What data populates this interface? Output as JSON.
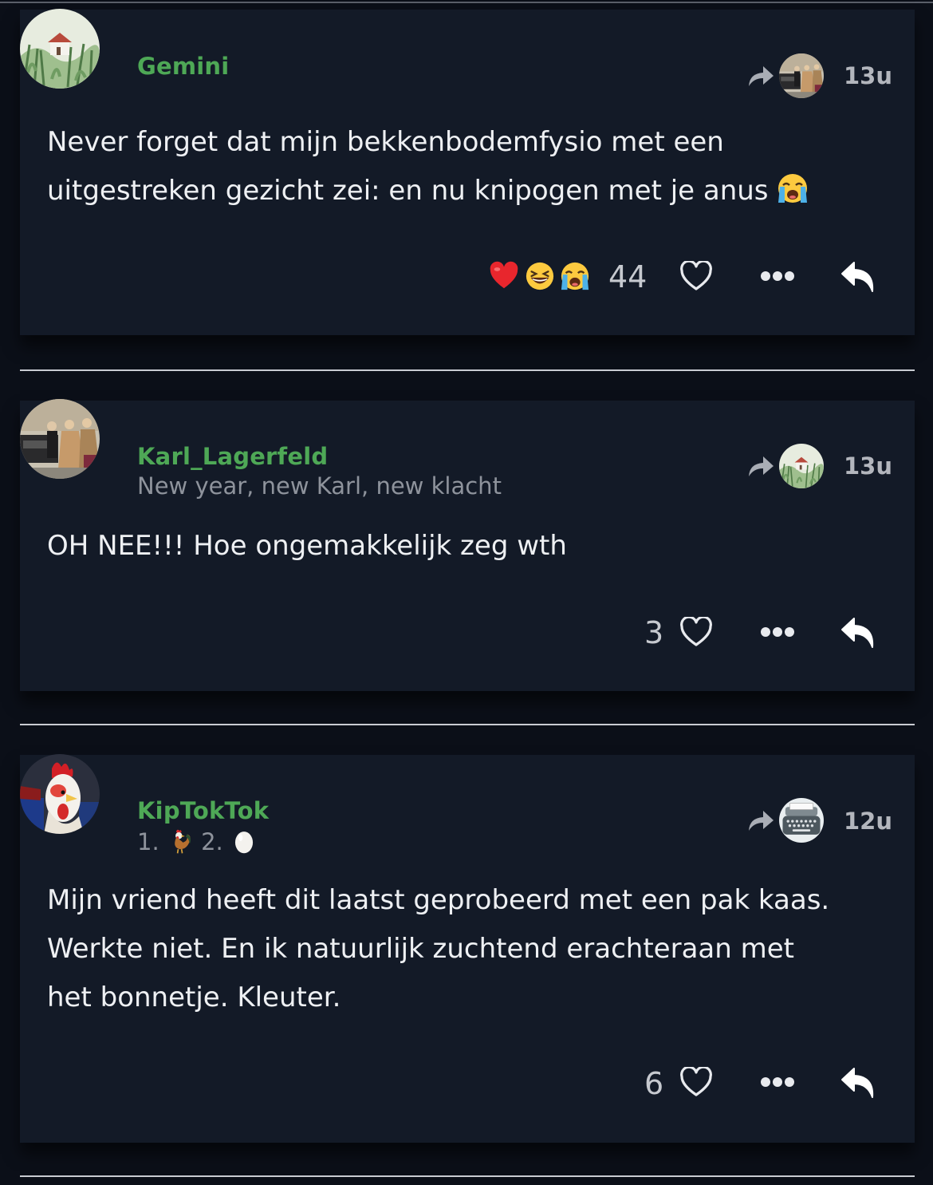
{
  "posts": [
    {
      "username": "Gemini",
      "subtitle": "",
      "time": "13u",
      "text": "Never forget dat mijn bekkenbodemfysio met een uitgestreken gezicht zei: en nu knipogen met je anus",
      "text_emoji": "loudly-crying-face",
      "reactions": [
        "red-heart",
        "grinning-squinting-face",
        "loudly-crying-face"
      ],
      "count": "44",
      "avatar": "countryside-house-avatar",
      "reposted_by_avatar": "street-photo-avatar"
    },
    {
      "username": "Karl_Lagerfeld",
      "subtitle": "New year, new Karl, new klacht",
      "time": "13u",
      "text": "OH NEE!!! Hoe ongemakkelijk zeg wth",
      "reactions": [],
      "count": "3",
      "avatar": "street-photo-avatar",
      "reposted_by_avatar": "countryside-house-avatar"
    },
    {
      "username": "KipTokTok",
      "subtitle_parts": [
        "1.",
        "2."
      ],
      "subtitle_emojis": [
        "rooster",
        "egg"
      ],
      "time": "12u",
      "text": "Mijn vriend heeft dit laatst geprobeerd met een pak kaas. Werkte niet. En ik natuurlijk zuchtend erachteraan met het bonnetje. Kleuter.",
      "reactions": [],
      "count": "6",
      "avatar": "rooster-avatar",
      "reposted_by_avatar": "typewriter-avatar"
    }
  ],
  "colors": {
    "background": "#0b0f18",
    "card": "#131a27",
    "username": "#4ea856",
    "subtitle": "#8e939c",
    "text": "#eef0f3"
  }
}
